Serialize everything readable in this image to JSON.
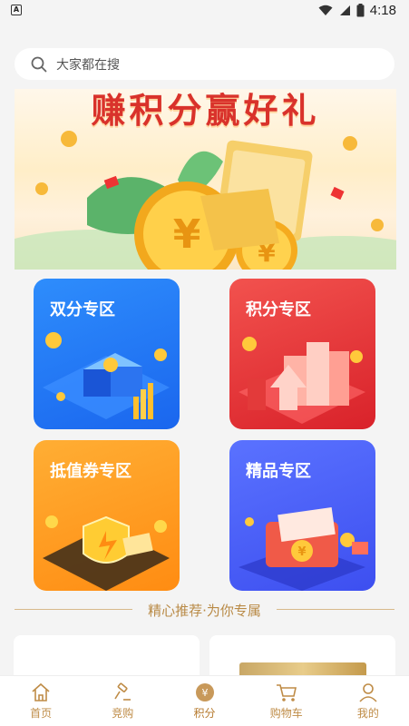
{
  "status_bar": {
    "time": "4:18",
    "app_badge": "A"
  },
  "search": {
    "placeholder": "大家都在搜"
  },
  "banner": {
    "title": "赚积分赢好礼"
  },
  "zones": [
    {
      "label": "双分专区"
    },
    {
      "label": "积分专区"
    },
    {
      "label": "抵值券专区"
    },
    {
      "label": "精品专区"
    }
  ],
  "section": {
    "title": "精心推荐·为你专属"
  },
  "tabbar": {
    "items": [
      {
        "label": "首页",
        "icon": "home-icon"
      },
      {
        "label": "竞购",
        "icon": "gavel-icon"
      },
      {
        "label": "积分",
        "icon": "points-coin-icon",
        "active": true
      },
      {
        "label": "购物车",
        "icon": "cart-icon"
      },
      {
        "label": "我的",
        "icon": "user-icon"
      }
    ]
  },
  "colors": {
    "accent": "#bf8c47",
    "banner_title": "#d9322b"
  }
}
